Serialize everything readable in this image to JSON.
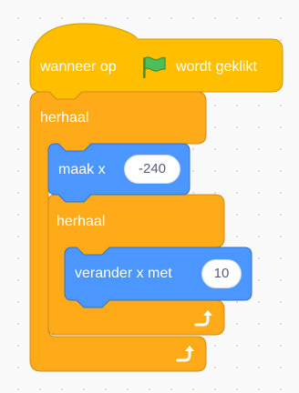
{
  "colors": {
    "events": "#ffbf00",
    "events_edge": "#cc9900",
    "control": "#ffab19",
    "control_edge": "#cf8b17",
    "motion": "#4c97ff",
    "motion_edge": "#3373cc",
    "flag": "#4cbf56"
  },
  "hat_block": {
    "label_before": "wanneer op",
    "icon": "green-flag-icon",
    "label_after": "wordt geklikt"
  },
  "outer_repeat": {
    "label": "herhaal",
    "loop_icon": "loop-arrow-icon"
  },
  "set_x_block": {
    "label": "maak x",
    "value": "-240"
  },
  "inner_repeat": {
    "label": "herhaal",
    "loop_icon": "loop-arrow-icon"
  },
  "change_x_block": {
    "label": "verander x met",
    "value": "10"
  }
}
